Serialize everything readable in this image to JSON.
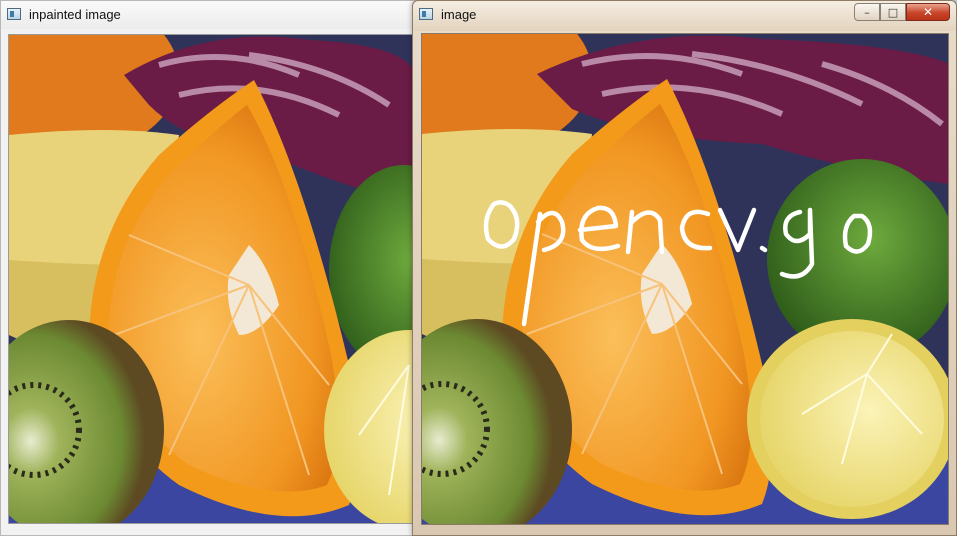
{
  "windows": {
    "left": {
      "title": "inpainted image"
    },
    "right": {
      "title": "image"
    }
  },
  "controls": {
    "minimize_icon": "minimize-icon",
    "maximize_icon": "maximize-icon",
    "close_icon": "close-icon"
  },
  "colors": {
    "orange_peel": "#f39a1b",
    "orange_flesh": "#f6a43a",
    "cabbage": "#6a1c46",
    "banana": "#e8d27a",
    "lime": "#4f8c2a",
    "lemon": "#f1e58b",
    "kiwi": "#7a9a3c",
    "background_blue": "#3c4a8e"
  }
}
